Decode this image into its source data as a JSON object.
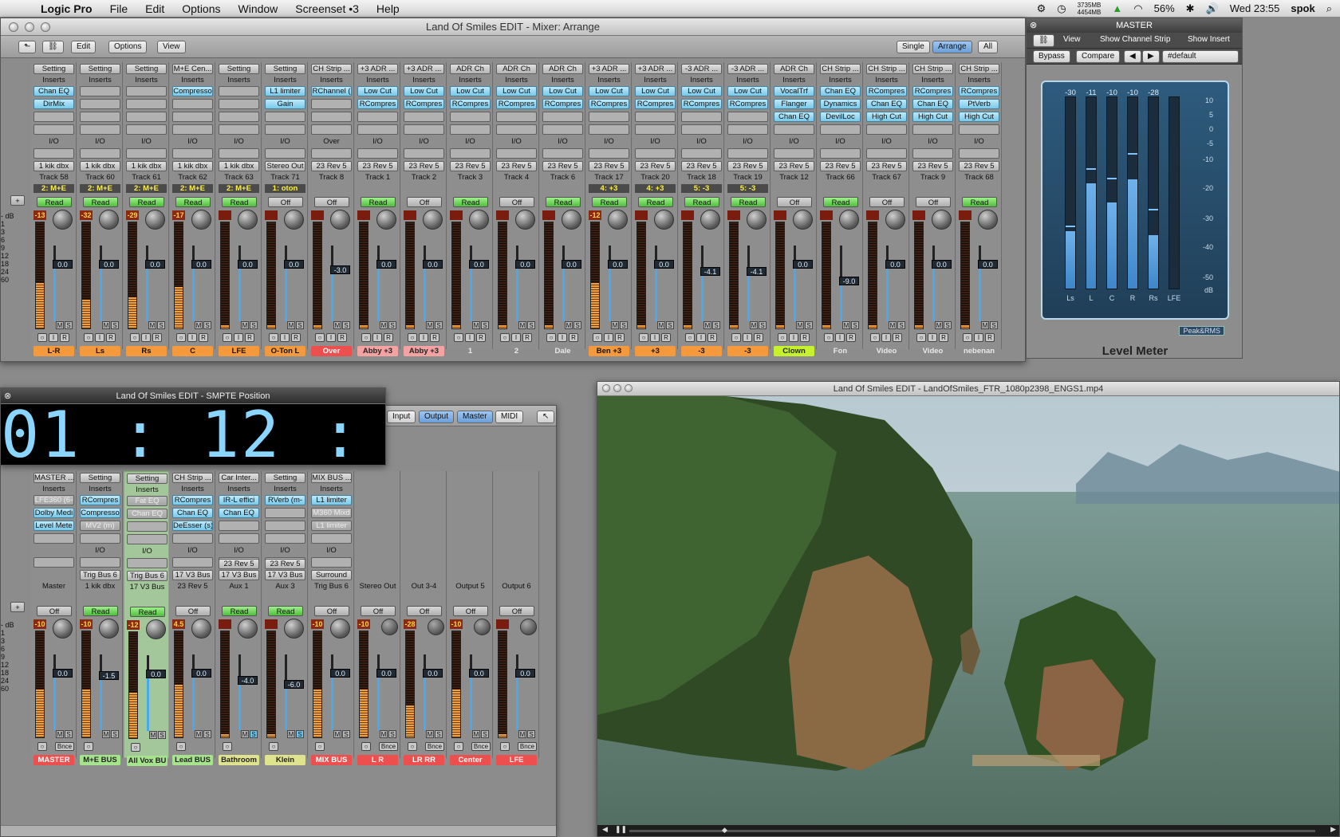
{
  "menubar": {
    "items": [
      "Logic Pro",
      "File",
      "Edit",
      "Options",
      "Window",
      "Screenset •3",
      "Help"
    ],
    "mem_top": "3735MB",
    "mem_bottom": "4454MB",
    "battery": "56%",
    "clock": "Wed 23:55",
    "user": "spok"
  },
  "mixer_window": {
    "title": "Land Of Smiles EDIT - Mixer: Arrange",
    "toolbar": {
      "edit": "Edit",
      "options": "Options",
      "view": "View"
    },
    "view_buttons": [
      "Single",
      "Arrange",
      "All"
    ],
    "type_buttons": [
      "Audio",
      "Inst",
      "Aux"
    ],
    "strips": [
      {
        "setting": "Setting",
        "inserts": [
          "Chan EQ",
          "DirMix"
        ],
        "io": "I/O",
        "send": "1 kik dbx",
        "out": "Track 58",
        "grp": "2: M+E",
        "auto": "Read",
        "peak": "-13",
        "vol": "0.0",
        "name": "L-R",
        "color": "orange"
      },
      {
        "setting": "Setting",
        "inserts": [],
        "io": "I/O",
        "send": "1 kik dbx",
        "out": "Track 60",
        "grp": "2: M+E",
        "auto": "Read",
        "peak": "-32",
        "vol": "0.0",
        "name": "Ls",
        "color": "orange"
      },
      {
        "setting": "Setting",
        "inserts": [],
        "io": "I/O",
        "send": "1 kik dbx",
        "out": "Track 61",
        "grp": "2: M+E",
        "auto": "Read",
        "peak": "-29",
        "vol": "0.0",
        "name": "Rs",
        "color": "orange"
      },
      {
        "setting": "M+E Cen...",
        "inserts": [
          "Compresso"
        ],
        "io": "I/O",
        "send": "1 kik dbx",
        "out": "Track 62",
        "grp": "2: M+E",
        "auto": "Read",
        "peak": "-17",
        "vol": "0.0",
        "name": "C",
        "color": "orange"
      },
      {
        "setting": "Setting",
        "inserts": [],
        "io": "I/O",
        "send": "1 kik dbx",
        "out": "Track 63",
        "grp": "2: M+E",
        "auto": "Read",
        "peak": "",
        "vol": "0.0",
        "name": "LFE",
        "color": "orange"
      },
      {
        "setting": "Setting",
        "inserts": [
          "L1 limiter",
          "Gain"
        ],
        "io": "I/O",
        "send": "Stereo Out",
        "out": "Track 71",
        "grp": "1: oton",
        "auto": "Off",
        "peak": "",
        "vol": "0.0",
        "name": "O-Ton L",
        "color": "orange"
      },
      {
        "setting": "CH Strip ...",
        "inserts": [
          "RChannel ("
        ],
        "io": "Over",
        "send": "23 Rev 5",
        "out": "Track 8",
        "grp": "",
        "auto": "Off",
        "peak": "",
        "vol": "-3.0",
        "name": "Over",
        "color": "red"
      },
      {
        "setting": "+3 ADR ...",
        "inserts": [
          "Low Cut",
          "RCompres"
        ],
        "io": "I/O",
        "send": "23 Rev 5",
        "out": "Track 1",
        "grp": "",
        "auto": "Read",
        "peak": "",
        "vol": "0.0",
        "name": "Abby +3",
        "color": "pink"
      },
      {
        "setting": "+3 ADR ...",
        "inserts": [
          "Low Cut",
          "RCompres"
        ],
        "io": "I/O",
        "send": "23 Rev 5",
        "out": "Track 2",
        "grp": "",
        "auto": "Off",
        "peak": "",
        "vol": "0.0",
        "name": "Abby +3",
        "color": "pink"
      },
      {
        "setting": "ADR Ch",
        "inserts": [
          "Low Cut",
          "RCompres"
        ],
        "io": "I/O",
        "send": "23 Rev 5",
        "out": "Track 3",
        "grp": "",
        "auto": "Read",
        "peak": "",
        "vol": "0.0",
        "name": "1",
        "color": "none"
      },
      {
        "setting": "ADR Ch",
        "inserts": [
          "Low Cut",
          "RCompres"
        ],
        "io": "I/O",
        "send": "23 Rev 5",
        "out": "Track 4",
        "grp": "",
        "auto": "Off",
        "peak": "",
        "vol": "0.0",
        "name": "2",
        "color": "none"
      },
      {
        "setting": "ADR Ch",
        "inserts": [
          "Low Cut",
          "RCompres"
        ],
        "io": "I/O",
        "send": "23 Rev 5",
        "out": "Track 6",
        "grp": "",
        "auto": "Read",
        "peak": "",
        "vol": "0.0",
        "name": "Dale",
        "color": "none"
      },
      {
        "setting": "+3 ADR ...",
        "inserts": [
          "Low Cut",
          "RCompres"
        ],
        "io": "I/O",
        "send": "23 Rev 5",
        "out": "Track 17",
        "grp": "4: +3",
        "auto": "Read",
        "peak": "-12",
        "vol": "0.0",
        "name": "Ben +3",
        "color": "orange"
      },
      {
        "setting": "+3 ADR ...",
        "inserts": [
          "Low Cut",
          "RCompres"
        ],
        "io": "I/O",
        "send": "23 Rev 5",
        "out": "Track 20",
        "grp": "4: +3",
        "auto": "Read",
        "peak": "",
        "vol": "0.0",
        "name": "+3",
        "color": "orange"
      },
      {
        "setting": "-3 ADR ...",
        "inserts": [
          "Low Cut",
          "RCompres"
        ],
        "io": "I/O",
        "send": "23 Rev 5",
        "out": "Track 18",
        "grp": "5: -3",
        "auto": "Read",
        "peak": "",
        "vol": "-4.1",
        "name": "-3",
        "color": "orange"
      },
      {
        "setting": "-3 ADR ...",
        "inserts": [
          "Low Cut",
          "RCompres"
        ],
        "io": "I/O",
        "send": "23 Rev 5",
        "out": "Track 19",
        "grp": "5: -3",
        "auto": "Read",
        "peak": "",
        "vol": "-4.1",
        "name": "-3",
        "color": "orange"
      },
      {
        "setting": "ADR Ch",
        "inserts": [
          "VocalTrf",
          "Flanger",
          "Chan EQ"
        ],
        "io": "I/O",
        "send": "23 Rev 5",
        "out": "Track 12",
        "grp": "",
        "auto": "Off",
        "peak": "",
        "vol": "0.0",
        "name": "Clown",
        "color": "lime"
      },
      {
        "setting": "CH Strip ...",
        "inserts": [
          "Chan EQ",
          "Dynamics",
          "DevilLoc"
        ],
        "io": "I/O",
        "send": "23 Rev 5",
        "out": "Track 66",
        "grp": "",
        "auto": "Read",
        "peak": "",
        "vol": "-9.0",
        "name": "Fon",
        "color": "none"
      },
      {
        "setting": "CH Strip ...",
        "inserts": [
          "RCompres",
          "Chan EQ",
          "High Cut"
        ],
        "io": "I/O",
        "send": "23 Rev 5",
        "out": "Track 67",
        "grp": "",
        "auto": "Off",
        "peak": "",
        "vol": "0.0",
        "name": "Video",
        "color": "none"
      },
      {
        "setting": "CH Strip ...",
        "inserts": [
          "RCompres",
          "Chan EQ",
          "High Cut"
        ],
        "io": "I/O",
        "send": "23 Rev 5",
        "out": "Track 9",
        "grp": "",
        "auto": "Off",
        "peak": "",
        "vol": "0.0",
        "name": "Video",
        "color": "none"
      },
      {
        "setting": "CH Strip ...",
        "inserts": [
          "RCompres",
          "PtVerb",
          "High Cut"
        ],
        "io": "I/O",
        "send": "23 Rev 5",
        "out": "Track 68",
        "grp": "",
        "auto": "Read",
        "peak": "",
        "vol": "0.0",
        "name": "nebenan",
        "color": "none"
      }
    ],
    "scale": [
      "- dB",
      "1",
      "3",
      "6",
      "9",
      "12",
      "18",
      "24",
      "60"
    ]
  },
  "smpte": {
    "title": "Land Of Smiles EDIT - SMPTE Position",
    "timecode": "01 : 12 : 26 : 17"
  },
  "lower_mixer": {
    "tabs": [
      "Input",
      "Output",
      "Master",
      "MIDI"
    ],
    "strips": [
      {
        "setting": "MASTER ...",
        "inserts": [
          "LFE360 (6-",
          "Dolby Medi",
          "Level Mete"
        ],
        "io": "",
        "send": "",
        "out": "Master",
        "auto": "Off",
        "peak": "-10",
        "vol": "0.0",
        "name": "MASTER",
        "color": "red",
        "bottom": "Bnce"
      },
      {
        "setting": "Setting",
        "inserts": [
          "RCompres",
          "Compresso",
          "MV2 (m)"
        ],
        "io": "I/O",
        "send": "Trig Bus 6",
        "out": "1 kik dbx",
        "auto": "Read",
        "peak": "-10",
        "vol": "-1.5",
        "name": "M+E BUS",
        "color": "green",
        "bottom": ""
      },
      {
        "setting": "Setting",
        "inserts": [
          "Fat EQ",
          "Chan EQ"
        ],
        "io": "I/O",
        "send": "Trig Bus 6",
        "out": "17 V3 Bus",
        "auto": "Read",
        "peak": "-12",
        "vol": "0.0",
        "name": "All Vox BU",
        "color": "green",
        "bottom": ""
      },
      {
        "setting": "CH Strip ...",
        "inserts": [
          "RCompres",
          "Chan EQ",
          "DeEsser (s)"
        ],
        "io": "I/O",
        "send": "17 V3 Bus",
        "out": "23 Rev 5",
        "auto": "Off",
        "peak": "4.5",
        "vol": "0.0",
        "name": "Lead BUS",
        "color": "green",
        "bottom": ""
      },
      {
        "setting": "Car Inter...",
        "inserts": [
          "IR-L effici",
          "Chan EQ"
        ],
        "io": "I/O",
        "send": "23 Rev 5",
        "send2": "17 V3 Bus",
        "out": "Aux 1",
        "auto": "Read",
        "peak": "",
        "vol": "-4.0",
        "name": "Bathroom",
        "color": "olive",
        "bottom": ""
      },
      {
        "setting": "Setting",
        "inserts": [
          "RVerb (m-"
        ],
        "io": "I/O",
        "send": "23 Rev 5",
        "send2": "17 V3 Bus",
        "out": "Aux 3",
        "auto": "Read",
        "peak": "",
        "vol": "-6.0",
        "name": "Klein",
        "color": "olive",
        "bottom": ""
      },
      {
        "setting": "MIX BUS ...",
        "inserts": [
          "L1 limiter",
          "M360 Mixd",
          "L1 limiter"
        ],
        "io": "I/O",
        "send": "Surround",
        "out": "Trig Bus 6",
        "auto": "Off",
        "peak": "-10",
        "vol": "0.0",
        "name": "MIX BUS",
        "color": "red",
        "bottom": ""
      },
      {
        "setting": "",
        "inserts": [],
        "io": "",
        "send": "",
        "out": "Stereo Out",
        "auto": "Off",
        "peak": "-10",
        "vol": "0.0",
        "name": "L R",
        "color": "red",
        "bottom": "Bnce"
      },
      {
        "setting": "",
        "inserts": [],
        "io": "",
        "send": "",
        "out": "Out 3-4",
        "auto": "Off",
        "peak": "-28",
        "vol": "0.0",
        "name": "LR RR",
        "color": "red",
        "bottom": "Bnce"
      },
      {
        "setting": "",
        "inserts": [],
        "io": "",
        "send": "",
        "out": "Output 5",
        "auto": "Off",
        "peak": "-10",
        "vol": "0.0",
        "name": "Center",
        "color": "red",
        "bottom": "Bnce"
      },
      {
        "setting": "",
        "inserts": [],
        "io": "",
        "send": "",
        "out": "Output 6",
        "auto": "Off",
        "peak": "",
        "vol": "0.0",
        "name": "LFE",
        "color": "red",
        "bottom": "Bnce"
      }
    ]
  },
  "video": {
    "title": "Land Of Smiles EDIT - LandOfSmiles_FTR_1080p2398_ENGS1.mp4"
  },
  "level_meter": {
    "title": "MASTER",
    "view": "View",
    "show_channel_strip": "Show Channel Strip",
    "show_insert": "Show Insert",
    "bypass": "Bypass",
    "compare": "Compare",
    "preset": "#default",
    "mode": "Peak&RMS",
    "plugin_name": "Level Meter",
    "channels": [
      {
        "name": "Ls",
        "peak": "-30",
        "level": 0.3,
        "hold": 0.32
      },
      {
        "name": "L",
        "peak": "-11",
        "level": 0.55,
        "hold": 0.62
      },
      {
        "name": "C",
        "peak": "-10",
        "level": 0.45,
        "hold": 0.57
      },
      {
        "name": "R",
        "peak": "-10",
        "level": 0.57,
        "hold": 0.7
      },
      {
        "name": "Rs",
        "peak": "-28",
        "level": 0.28,
        "hold": 0.41
      },
      {
        "name": "LFE",
        "peak": "",
        "level": 0,
        "hold": 0
      }
    ],
    "scale": [
      "10",
      "5",
      "0",
      "-5",
      "-10",
      "-20",
      "-30",
      "-40",
      "-50",
      "dB"
    ]
  }
}
